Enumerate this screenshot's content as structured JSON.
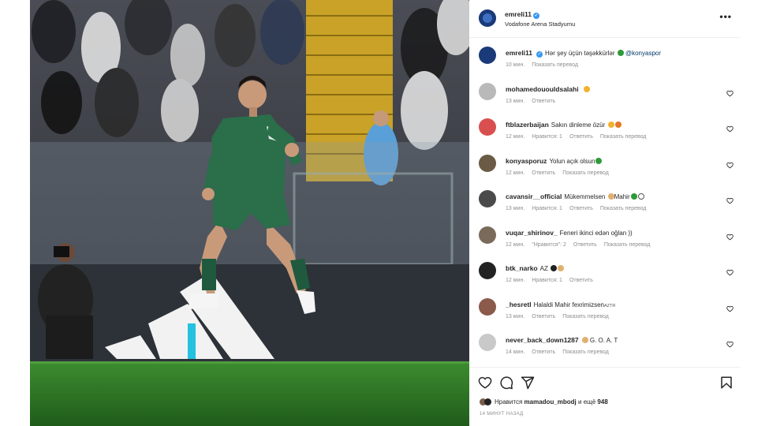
{
  "post": {
    "author": "emreli11",
    "location": "Vodafone Arena Stadyumu",
    "more_icon": "more-horizontal-icon"
  },
  "comments": [
    {
      "user": "emreli11",
      "text": "Hər şey üçün təşəkkürlər",
      "mention": "@konyaspor",
      "time": "10 мин.",
      "actions": [
        "Показать перевод"
      ],
      "verified": true,
      "heart": false,
      "avatar_color": "#1a3a7a"
    },
    {
      "user": "mohamedououldsalahi",
      "text": "",
      "time": "13 мин.",
      "actions": [
        "Ответить"
      ],
      "heart": true,
      "avatar_color": "#b9b9b9"
    },
    {
      "user": "ftblazerbaijan",
      "text": "Sakın dinleme özür",
      "time": "12 мин.",
      "actions": [
        "Нравится: 1",
        "Ответить",
        "Показать перевод"
      ],
      "heart": true,
      "avatar_color": "#d94f4f"
    },
    {
      "user": "konyasporuz",
      "text": "Yolun açık olsun",
      "time": "12 мин.",
      "actions": [
        "Ответить",
        "Показать перевод"
      ],
      "heart": true,
      "avatar_color": "#6b5a45"
    },
    {
      "user": "cavansir__official",
      "text": "Mükemmelsen",
      "text2": "Mahir",
      "time": "13 мин.",
      "actions": [
        "Нравится: 1",
        "Ответить",
        "Показать перевод"
      ],
      "heart": true,
      "avatar_color": "#4a4a4a"
    },
    {
      "user": "vuqar_shirinov_",
      "text": "Feneri ikinci edən oğlan ))",
      "time": "12 мин.",
      "actions": [
        "\"Нравится\": 2",
        "Ответить",
        "Показать перевод"
      ],
      "heart": true,
      "avatar_color": "#7a6a5a"
    },
    {
      "user": "btk_narko",
      "text": "AZ",
      "time": "12 мин.",
      "actions": [
        "Нравится: 1",
        "Ответить"
      ],
      "heart": true,
      "avatar_color": "#222222"
    },
    {
      "user": "_hesretl",
      "text": "Halaldi Mahir fexrimizsen",
      "suffix": "AZTR",
      "time": "13 мин.",
      "actions": [
        "Ответить",
        "Показать перевод"
      ],
      "heart": true,
      "avatar_color": "#8a5a4a"
    },
    {
      "user": "never_back_down1287",
      "text": "G. O. A. T",
      "time": "14 мин.",
      "actions": [
        "Ответить",
        "Показать перевод"
      ],
      "heart": true,
      "avatar_color": "#c9c9c9"
    }
  ],
  "footer": {
    "likes_prefix": "Нравится",
    "liker": "mamadou_mbodj",
    "likes_mid": "и ещё",
    "likes_count": "948",
    "posted_ago": "14 МИНУТ НАЗАД",
    "icons": [
      "heart-icon",
      "comment-icon",
      "share-icon",
      "bookmark-icon"
    ]
  },
  "colors": {
    "verified": "#3897f0",
    "pitch": "#2f7a2a",
    "kit": "#1f5a3e"
  }
}
